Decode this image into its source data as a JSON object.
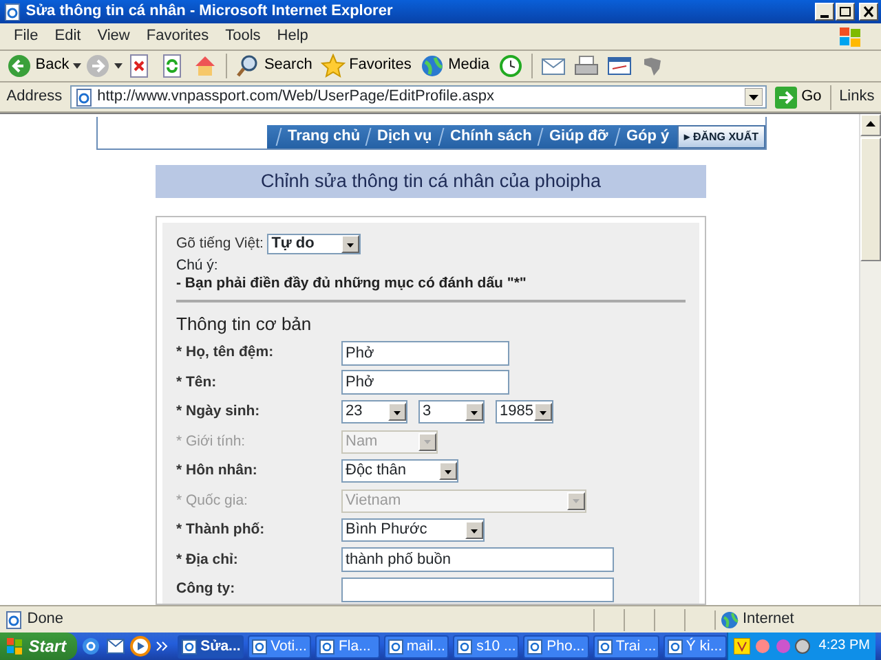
{
  "window": {
    "title": "Sửa thông tin cá nhân - Microsoft Internet Explorer"
  },
  "menu": [
    "File",
    "Edit",
    "View",
    "Favorites",
    "Tools",
    "Help"
  ],
  "toolbar": [
    {
      "kind": "back",
      "label": "Back"
    },
    {
      "kind": "forward"
    },
    {
      "kind": "stop"
    },
    {
      "kind": "refresh"
    },
    {
      "kind": "home"
    },
    {
      "kind": "search",
      "label": "Search"
    },
    {
      "kind": "favorites",
      "label": "Favorites"
    },
    {
      "kind": "media",
      "label": "Media"
    },
    {
      "kind": "history"
    },
    {
      "kind": "mail"
    },
    {
      "kind": "print"
    },
    {
      "kind": "edit"
    },
    {
      "kind": "messenger"
    }
  ],
  "address": {
    "label": "Address",
    "url": "http://www.vnpassport.com/Web/UserPage/EditProfile.aspx",
    "go": "Go",
    "links": "Links"
  },
  "site_nav": {
    "items": [
      "Trang chủ",
      "Dịch vụ",
      "Chính sách",
      "Giúp đỡ",
      "Góp ý"
    ],
    "logout": "▸ ĐĂNG XUẤT"
  },
  "heading": "Chỉnh sửa thông tin cá nhân của phoipha",
  "typing_mode": {
    "label": "Gõ tiếng Việt:",
    "value": "Tự do"
  },
  "note": {
    "title": "Chú ý:",
    "text": "- Bạn phải điền đầy đủ những mục có đánh dấu \"*\""
  },
  "section_title": "Thông tin cơ bản",
  "fields": [
    {
      "label": "* Họ, tên đệm:",
      "kind": "text",
      "value": "Phở",
      "disabled": false
    },
    {
      "label": "* Tên:",
      "kind": "text",
      "value": "Phở",
      "disabled": false
    },
    {
      "label": "* Ngày sinh:",
      "kind": "date",
      "values": [
        "23",
        "3",
        "1985"
      ],
      "disabled": false
    },
    {
      "label": "* Giới tính:",
      "kind": "select",
      "value": "Nam",
      "disabled": true
    },
    {
      "label": "* Hôn nhân:",
      "kind": "select",
      "value": "Độc thân",
      "disabled": false
    },
    {
      "label": "* Quốc gia:",
      "kind": "select",
      "value": "Vietnam",
      "disabled": true
    },
    {
      "label": "* Thành phố:",
      "kind": "select",
      "value": "Bình Phước",
      "disabled": false
    },
    {
      "label": "* Địa chỉ:",
      "kind": "text",
      "value": "thành phố buồn",
      "disabled": false
    },
    {
      "label": "Công ty:",
      "kind": "text",
      "disabled": false
    }
  ],
  "status_bar": {
    "text": "Done",
    "zone": "Internet"
  },
  "taskbar": {
    "start": "Start",
    "tasks": [
      {
        "label": "Sửa...",
        "selected": true
      },
      {
        "label": "Voti...",
        "selected": false
      },
      {
        "label": "Fla...",
        "selected": false
      },
      {
        "label": "mail...",
        "selected": false
      },
      {
        "label": "s10 ...",
        "selected": false
      },
      {
        "label": "Pho...",
        "selected": false
      },
      {
        "label": "Trai ...",
        "selected": false
      },
      {
        "label": "Ý ki...",
        "selected": false
      }
    ],
    "clock": "4:23 PM"
  }
}
